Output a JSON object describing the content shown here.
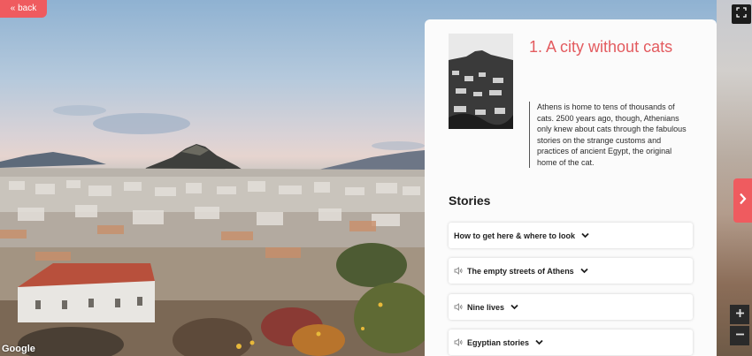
{
  "nav": {
    "back_label": "« back"
  },
  "card": {
    "title": "1. A city without cats",
    "intro": "Athens is home to tens of thousands of cats. 2500 years ago, though, Athenians only knew about cats through the fabulous stories on the strange customs and practices of ancient Egypt, the original home of the cat."
  },
  "stories": {
    "heading": "Stories",
    "items": [
      {
        "label": "How to get here & where to look",
        "audio": false
      },
      {
        "label": "The empty streets of Athens",
        "audio": true
      },
      {
        "label": "Nine lives",
        "audio": true
      },
      {
        "label": "Egyptian stories",
        "audio": true
      }
    ]
  },
  "map": {
    "attribution": "Google"
  },
  "colors": {
    "accent": "#ef5b5f",
    "title": "#e35b5f",
    "panel": "#fbfbfb",
    "control_bg": "#2a2a2a"
  },
  "icons": {
    "fullscreen": "fullscreen-icon",
    "next": "chevron-right-icon",
    "zoom_in": "plus-icon",
    "zoom_out": "minus-icon",
    "audio": "speaker-icon",
    "expand": "chevron-down-icon"
  }
}
